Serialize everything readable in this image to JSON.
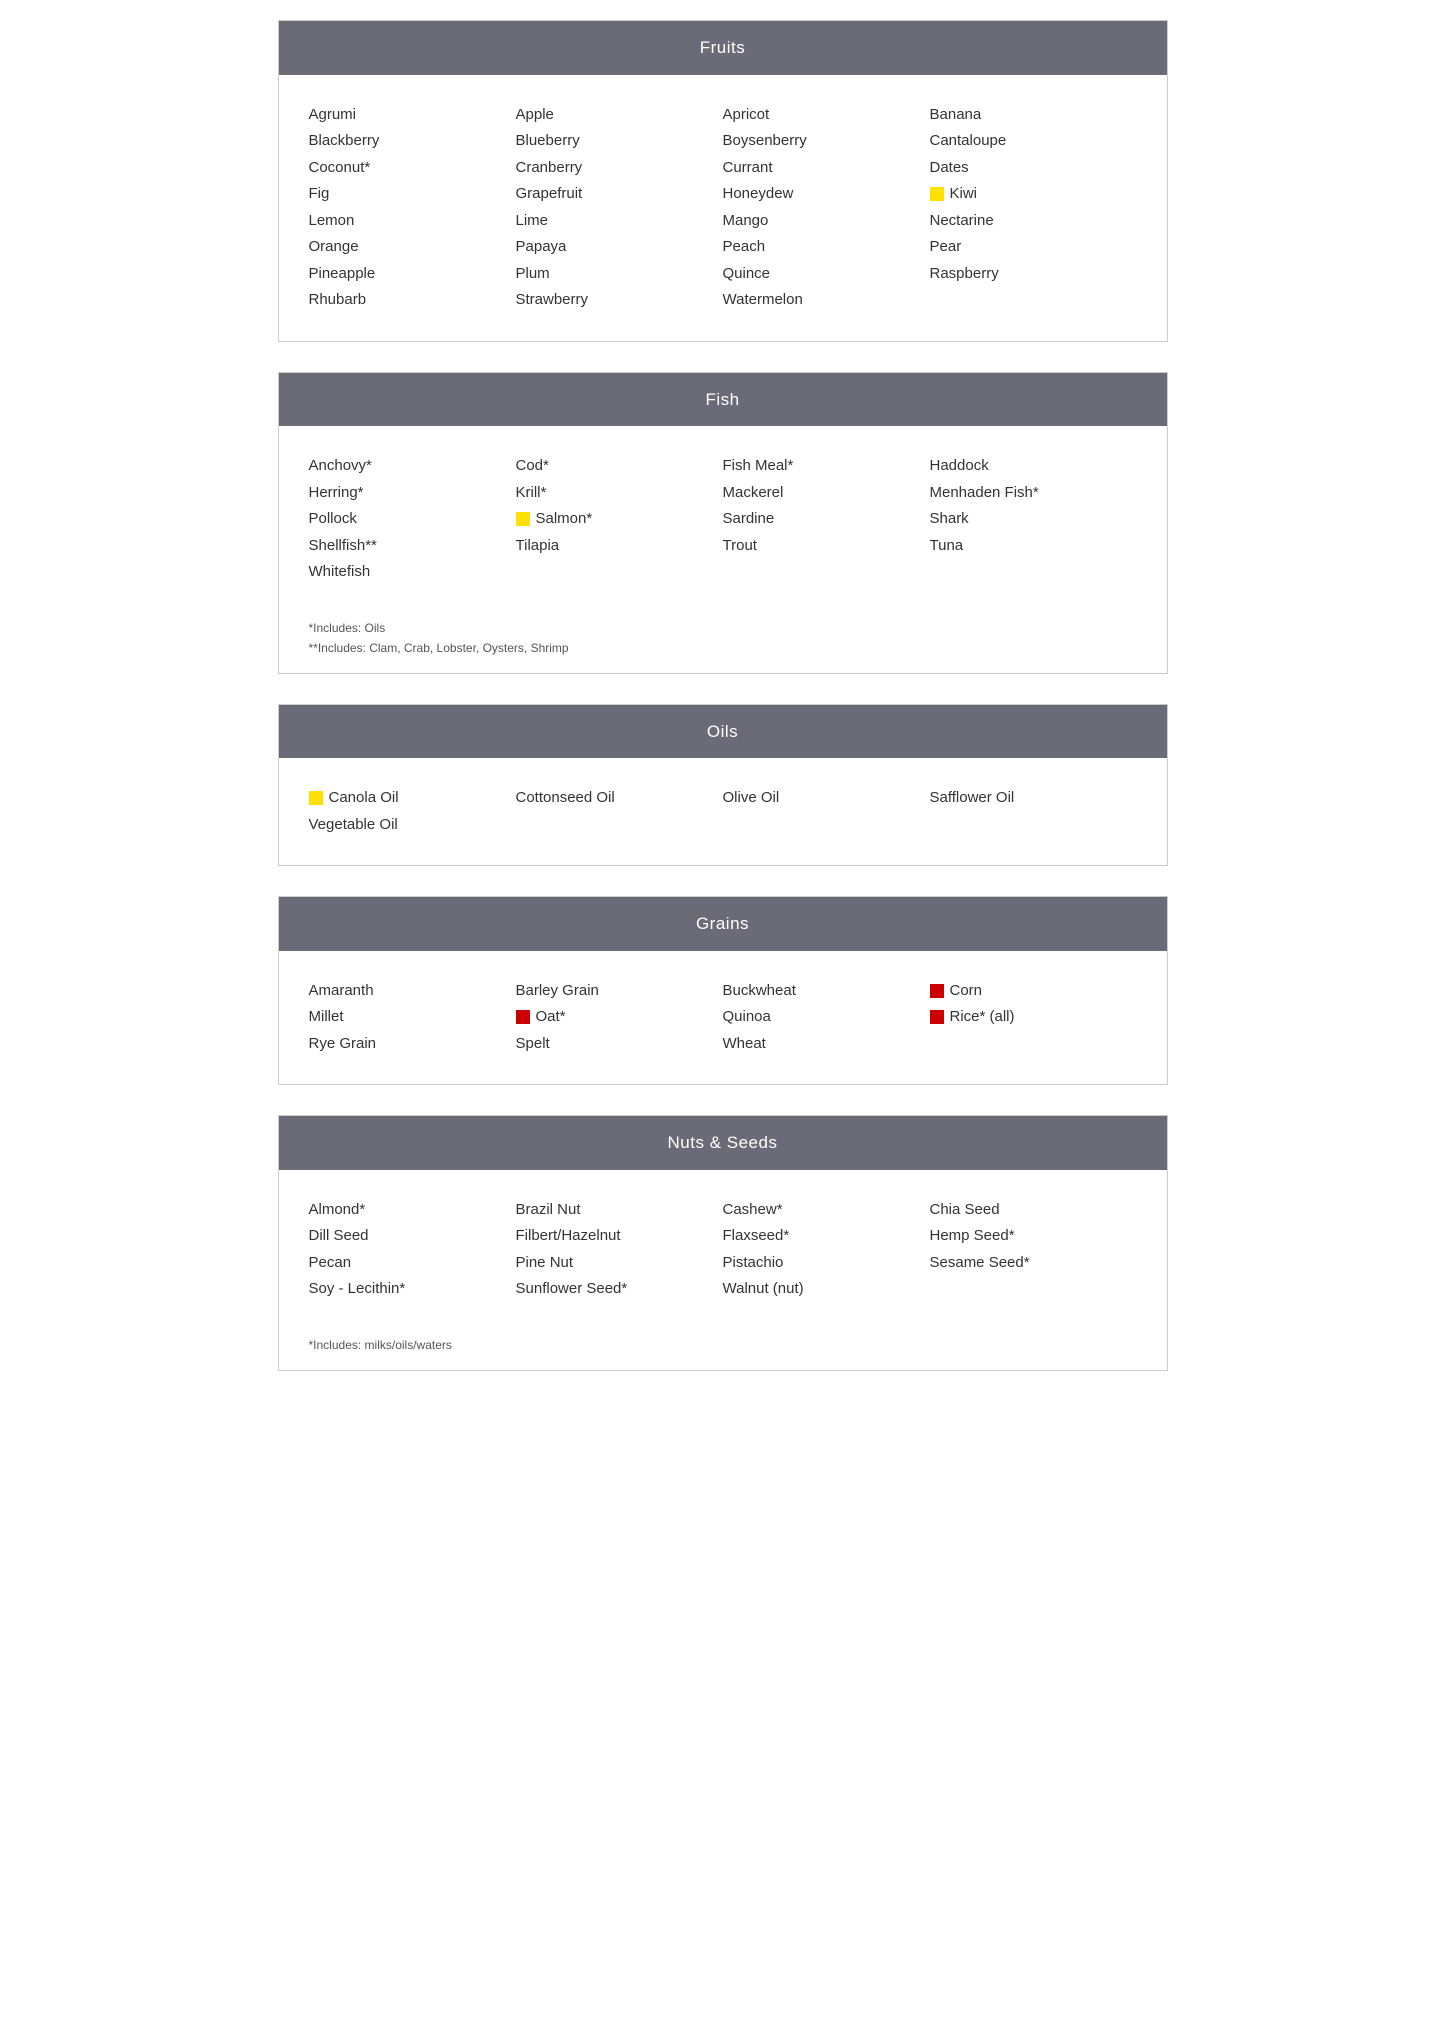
{
  "sections": [
    {
      "id": "fruits",
      "header": "Fruits",
      "columns": [
        [
          {
            "text": "Agrumi",
            "marker": null
          },
          {
            "text": "Blackberry",
            "marker": null
          },
          {
            "text": "Coconut*",
            "marker": null
          },
          {
            "text": "Fig",
            "marker": null
          },
          {
            "text": "Lemon",
            "marker": null
          },
          {
            "text": "Orange",
            "marker": null
          },
          {
            "text": "Pineapple",
            "marker": null
          },
          {
            "text": "Rhubarb",
            "marker": null
          }
        ],
        [
          {
            "text": "Apple",
            "marker": null
          },
          {
            "text": "Blueberry",
            "marker": null
          },
          {
            "text": "Cranberry",
            "marker": null
          },
          {
            "text": "Grapefruit",
            "marker": null
          },
          {
            "text": "Lime",
            "marker": null
          },
          {
            "text": "Papaya",
            "marker": null
          },
          {
            "text": "Plum",
            "marker": null
          },
          {
            "text": "Strawberry",
            "marker": null
          }
        ],
        [
          {
            "text": "Apricot",
            "marker": null
          },
          {
            "text": "Boysenberry",
            "marker": null
          },
          {
            "text": "Currant",
            "marker": null
          },
          {
            "text": "Honeydew",
            "marker": null
          },
          {
            "text": "Mango",
            "marker": null
          },
          {
            "text": "Peach",
            "marker": null
          },
          {
            "text": "Quince",
            "marker": null
          },
          {
            "text": "Watermelon",
            "marker": null
          }
        ],
        [
          {
            "text": "Banana",
            "marker": null
          },
          {
            "text": "Cantaloupe",
            "marker": null
          },
          {
            "text": "Dates",
            "marker": null
          },
          {
            "text": "Kiwi",
            "marker": "yellow"
          },
          {
            "text": "Nectarine",
            "marker": null
          },
          {
            "text": "Pear",
            "marker": null
          },
          {
            "text": "Raspberry",
            "marker": null
          }
        ]
      ],
      "footnotes": []
    },
    {
      "id": "fish",
      "header": "Fish",
      "columns": [
        [
          {
            "text": "Anchovy*",
            "marker": null
          },
          {
            "text": "Herring*",
            "marker": null
          },
          {
            "text": "Pollock",
            "marker": null
          },
          {
            "text": "Shellfish**",
            "marker": null
          },
          {
            "text": "Whitefish",
            "marker": null
          }
        ],
        [
          {
            "text": "Cod*",
            "marker": null
          },
          {
            "text": "Krill*",
            "marker": null
          },
          {
            "text": "Salmon*",
            "marker": "yellow"
          },
          {
            "text": "Tilapia",
            "marker": null
          }
        ],
        [
          {
            "text": "Fish Meal*",
            "marker": null
          },
          {
            "text": "Mackerel",
            "marker": null
          },
          {
            "text": "Sardine",
            "marker": null
          },
          {
            "text": "Trout",
            "marker": null
          }
        ],
        [
          {
            "text": "Haddock",
            "marker": null
          },
          {
            "text": "Menhaden Fish*",
            "marker": null
          },
          {
            "text": "Shark",
            "marker": null
          },
          {
            "text": "Tuna",
            "marker": null
          }
        ]
      ],
      "footnotes": [
        "*Includes: Oils",
        "**Includes: Clam, Crab, Lobster, Oysters, Shrimp"
      ]
    },
    {
      "id": "oils",
      "header": "Oils",
      "columns": [
        [
          {
            "text": "Canola Oil",
            "marker": "yellow"
          },
          {
            "text": "Vegetable Oil",
            "marker": null
          }
        ],
        [
          {
            "text": "Cottonseed Oil",
            "marker": null
          }
        ],
        [
          {
            "text": "Olive Oil",
            "marker": null
          }
        ],
        [
          {
            "text": "Safflower Oil",
            "marker": null
          }
        ]
      ],
      "footnotes": []
    },
    {
      "id": "grains",
      "header": "Grains",
      "columns": [
        [
          {
            "text": "Amaranth",
            "marker": null
          },
          {
            "text": "Millet",
            "marker": null
          },
          {
            "text": "Rye Grain",
            "marker": null
          }
        ],
        [
          {
            "text": "Barley Grain",
            "marker": null
          },
          {
            "text": "Oat*",
            "marker": "red"
          },
          {
            "text": "Spelt",
            "marker": null
          }
        ],
        [
          {
            "text": "Buckwheat",
            "marker": null
          },
          {
            "text": "Quinoa",
            "marker": null
          },
          {
            "text": "Wheat",
            "marker": null
          }
        ],
        [
          {
            "text": "Corn",
            "marker": "red"
          },
          {
            "text": "Rice* (all)",
            "marker": "red"
          }
        ]
      ],
      "footnotes": []
    },
    {
      "id": "nuts-seeds",
      "header": "Nuts & Seeds",
      "columns": [
        [
          {
            "text": "Almond*",
            "marker": null
          },
          {
            "text": "Dill Seed",
            "marker": null
          },
          {
            "text": "Pecan",
            "marker": null
          },
          {
            "text": "Soy - Lecithin*",
            "marker": null
          }
        ],
        [
          {
            "text": "Brazil Nut",
            "marker": null
          },
          {
            "text": "Filbert/Hazelnut",
            "marker": null
          },
          {
            "text": "Pine Nut",
            "marker": null
          },
          {
            "text": "Sunflower Seed*",
            "marker": null
          }
        ],
        [
          {
            "text": "Cashew*",
            "marker": null
          },
          {
            "text": "Flaxseed*",
            "marker": null
          },
          {
            "text": "Pistachio",
            "marker": null
          },
          {
            "text": "Walnut (nut)",
            "marker": null
          }
        ],
        [
          {
            "text": "Chia Seed",
            "marker": null
          },
          {
            "text": "Hemp Seed*",
            "marker": null
          },
          {
            "text": "Sesame Seed*",
            "marker": null
          }
        ]
      ],
      "footnotes": [
        "*Includes: milks/oils/waters"
      ]
    }
  ]
}
